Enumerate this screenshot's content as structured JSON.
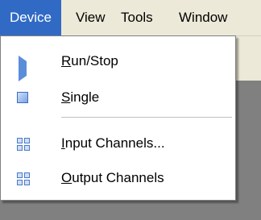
{
  "menubar": {
    "items": [
      {
        "label": "Device"
      },
      {
        "label": "View"
      },
      {
        "label": "Tools"
      },
      {
        "label": "Window"
      }
    ]
  },
  "device_menu": {
    "items": [
      {
        "prefix": "",
        "accel": "R",
        "rest": "un/Stop",
        "icon": "play-icon"
      },
      {
        "prefix": "",
        "accel": "S",
        "rest": "ingle",
        "icon": "stop-square-icon"
      },
      {
        "prefix": "",
        "accel": "I",
        "rest": "nput Channels...",
        "icon": "channels-icon"
      },
      {
        "prefix": "",
        "accel": "O",
        "rest": "utput Channels",
        "icon": "channels-icon"
      }
    ]
  },
  "colors": {
    "menu_highlight": "#316ac5",
    "icon_blue": "#5b8ed9"
  }
}
